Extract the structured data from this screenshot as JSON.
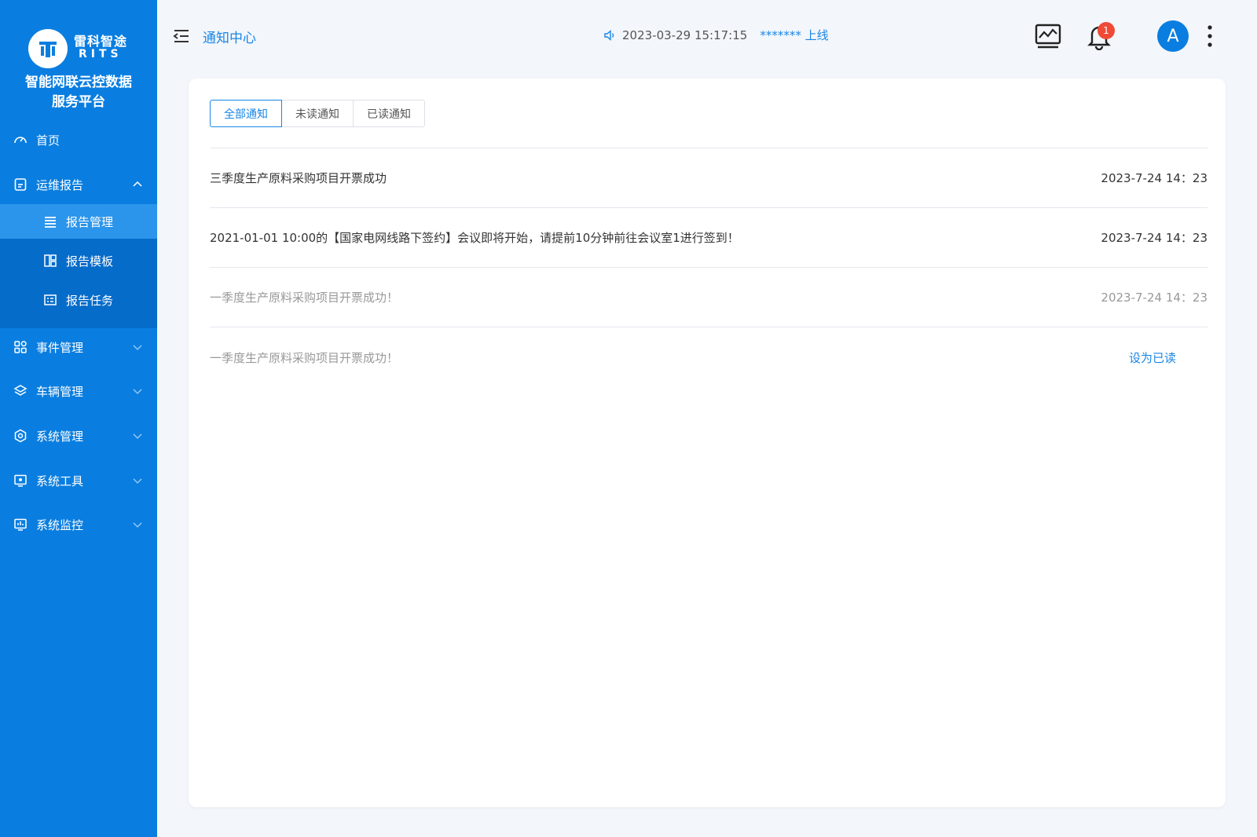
{
  "brand": {
    "logo_cn": "雷科智途",
    "logo_en": "RITS",
    "platform_title_line1": "智能网联云控数据",
    "platform_title_line2": "服务平台"
  },
  "sidebar": {
    "items": [
      {
        "label": "首页",
        "icon": "dashboard-icon"
      },
      {
        "label": "运维报告",
        "icon": "report-icon",
        "expanded": true,
        "children": [
          {
            "label": "报告管理",
            "icon": "list-icon",
            "active": true
          },
          {
            "label": "报告模板",
            "icon": "template-icon"
          },
          {
            "label": "报告任务",
            "icon": "task-icon"
          }
        ]
      },
      {
        "label": "事件管理",
        "icon": "grid-icon"
      },
      {
        "label": "车辆管理",
        "icon": "layers-icon"
      },
      {
        "label": "系统管理",
        "icon": "settings-icon"
      },
      {
        "label": "系统工具",
        "icon": "tools-icon"
      },
      {
        "label": "系统监控",
        "icon": "monitor-icon"
      }
    ]
  },
  "header": {
    "page_name": "通知中心",
    "datetime": "2023-03-29 15:17:15",
    "online_user": "******* 上线",
    "notification_count": "1",
    "avatar_letter": "A"
  },
  "tabs": [
    {
      "label": "全部通知",
      "active": true
    },
    {
      "label": "未读通知"
    },
    {
      "label": "已读通知"
    }
  ],
  "notifications": [
    {
      "text": "三季度生产原料采购项目开票成功",
      "time": "2023-7-24 14：23",
      "read": false
    },
    {
      "text": "2021-01-01 10:00的【国家电网线路下签约】会议即将开始，请提前10分钟前往会议室1进行签到！",
      "time": "2023-7-24 14：23",
      "read": false
    },
    {
      "text": "一季度生产原料采购项目开票成功！",
      "time": "2023-7-24 14：23",
      "read": true
    },
    {
      "text": "一季度生产原料采购项目开票成功！",
      "action": "设为已读",
      "read": true
    }
  ],
  "colors": {
    "sidebar": "#0a7ee0",
    "accent": "#1a86e6",
    "badge": "#f04a37"
  }
}
